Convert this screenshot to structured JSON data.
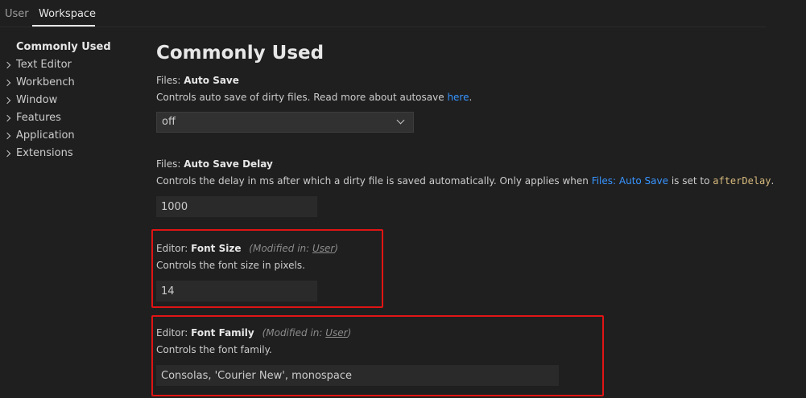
{
  "tabs": [
    {
      "label": "User",
      "active": false
    },
    {
      "label": "Workspace",
      "active": true
    }
  ],
  "toc": [
    {
      "label": "Commonly Used",
      "active": true,
      "expandable": false
    },
    {
      "label": "Text Editor",
      "expandable": true
    },
    {
      "label": "Workbench",
      "expandable": true
    },
    {
      "label": "Window",
      "expandable": true
    },
    {
      "label": "Features",
      "expandable": true
    },
    {
      "label": "Application",
      "expandable": true
    },
    {
      "label": "Extensions",
      "expandable": true
    }
  ],
  "heading": "Commonly Used",
  "settings": {
    "auto_save": {
      "category": "Files: ",
      "name": "Auto Save",
      "desc_before": "Controls auto save of dirty files. Read more about autosave ",
      "desc_link": "here",
      "desc_after": ".",
      "value": "off"
    },
    "auto_save_delay": {
      "category": "Files: ",
      "name": "Auto Save Delay",
      "desc_before": "Controls the delay in ms after which a dirty file is saved automatically. Only applies when ",
      "desc_link": "Files: Auto Save",
      "desc_mid": " is set to ",
      "desc_code": "afterDelay",
      "desc_after": ".",
      "value": "1000"
    },
    "font_size": {
      "category": "Editor: ",
      "name": "Font Size",
      "modified_prefix": "(Modified in: ",
      "modified_link": "User",
      "modified_suffix": ")",
      "desc": "Controls the font size in pixels.",
      "value": "14"
    },
    "font_family": {
      "category": "Editor: ",
      "name": "Font Family",
      "modified_prefix": "(Modified in: ",
      "modified_link": "User",
      "modified_suffix": ")",
      "desc": "Controls the font family.",
      "value": "Consolas, 'Courier New', monospace"
    }
  },
  "colors": {
    "background": "#1f1f1f",
    "link": "#3794ff",
    "highlight": "#e11414"
  }
}
